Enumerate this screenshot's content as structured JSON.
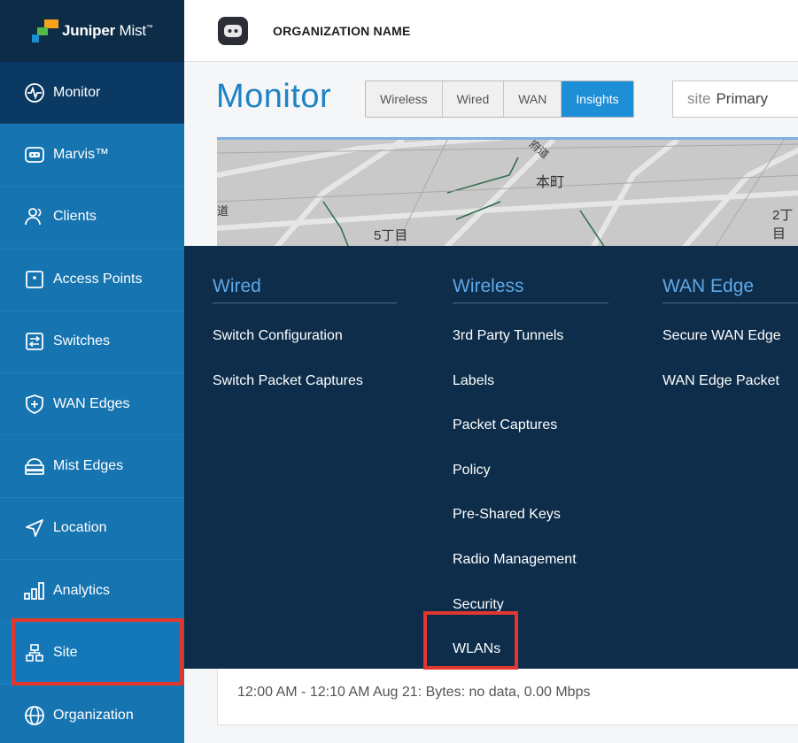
{
  "brand": {
    "name_bold": "Juniper",
    "name_rest": " Mist",
    "tm": "™"
  },
  "header": {
    "org_name": "ORGANIZATION NAME"
  },
  "sidebar": {
    "items": [
      {
        "label": "Monitor",
        "icon": "monitor-icon"
      },
      {
        "label": "Marvis™",
        "icon": "marvis-icon"
      },
      {
        "label": "Clients",
        "icon": "clients-icon"
      },
      {
        "label": "Access Points",
        "icon": "access-point-icon"
      },
      {
        "label": "Switches",
        "icon": "switch-icon"
      },
      {
        "label": "WAN Edges",
        "icon": "wan-edge-icon"
      },
      {
        "label": "Mist Edges",
        "icon": "mist-edge-icon"
      },
      {
        "label": "Location",
        "icon": "location-icon"
      },
      {
        "label": "Analytics",
        "icon": "analytics-icon"
      },
      {
        "label": "Site",
        "icon": "site-icon"
      },
      {
        "label": "Organization",
        "icon": "organization-icon"
      }
    ]
  },
  "main": {
    "title": "Monitor",
    "tabs": [
      "Wireless",
      "Wired",
      "WAN",
      "Insights"
    ],
    "site_select": {
      "key": "site",
      "value": "Primary"
    },
    "map_labels": [
      "本町",
      "5丁目",
      "2丁目",
      "道",
      "府道"
    ],
    "card_text": "12:00 AM - 12:10 AM Aug 21: Bytes: no data, 0.00 Mbps"
  },
  "menu": {
    "wired": {
      "title": "Wired",
      "items": [
        "Switch Configuration",
        "Switch Packet Captures"
      ]
    },
    "wireless": {
      "title": "Wireless",
      "items": [
        "3rd Party Tunnels",
        "Labels",
        "Packet Captures",
        "Policy",
        "Pre-Shared Keys",
        "Radio Management",
        "Security",
        "WLANs"
      ]
    },
    "wan_edge": {
      "title": "WAN Edge",
      "items": [
        "Secure WAN Edge",
        "WAN Edge Packet"
      ]
    }
  },
  "colors": {
    "sidebar": "#1674b1",
    "sidebar_active": "#0a3a63",
    "menu_bg": "#0d2d4a",
    "accent": "#1e8ed6",
    "highlight": "#e0382f"
  }
}
